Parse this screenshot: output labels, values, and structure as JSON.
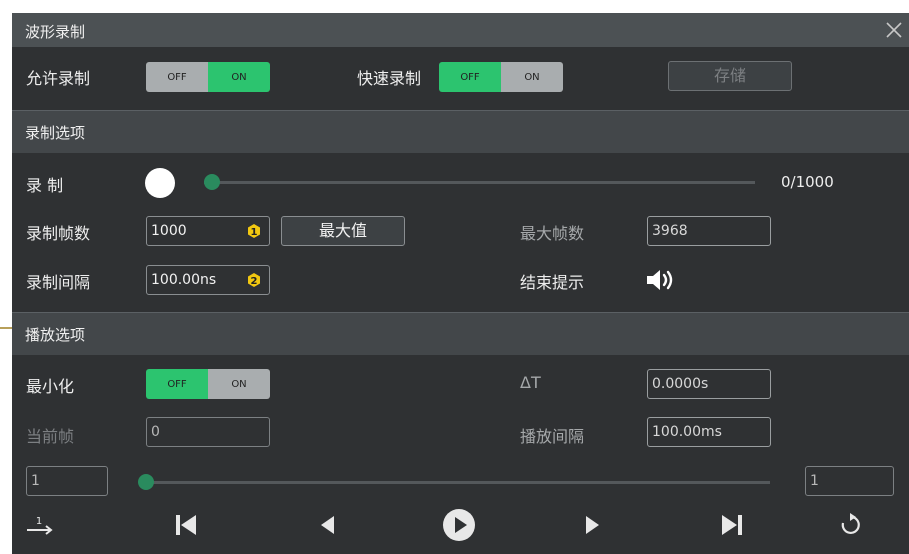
{
  "window": {
    "title": "波形录制"
  },
  "top": {
    "allow_label": "允许录制",
    "allow_toggle": {
      "off": "OFF",
      "on": "ON",
      "state": "ON"
    },
    "fast_label": "快速录制",
    "fast_toggle": {
      "off": "OFF",
      "on": "ON",
      "state": "OFF"
    },
    "save_label": "存储"
  },
  "record_section": {
    "title": "录制选项",
    "record_label": "录 制",
    "progress_text": "0/1000",
    "progress_value": 0,
    "frames_label": "录制帧数",
    "frames_value": "1000",
    "frames_badge": "1",
    "max_button": "最大值",
    "max_frames_label": "最大帧数",
    "max_frames_value": "3968",
    "interval_label": "录制间隔",
    "interval_value": "100.00ns",
    "interval_badge": "2",
    "end_hint_label": "结束提示",
    "end_hint_icon": "speaker-on-icon"
  },
  "play_section": {
    "title": "播放选项",
    "minimize_label": "最小化",
    "minimize_toggle": {
      "off": "OFF",
      "on": "ON",
      "state": "OFF"
    },
    "delta_t_label": "ΔT",
    "delta_t_value": "0.0000s",
    "current_frame_label": "当前帧",
    "current_frame_value": "0",
    "play_interval_label": "播放间隔",
    "play_interval_value": "100.00ms",
    "start_frame_value": "1",
    "end_frame_value": "1",
    "playback_position": 0
  },
  "toolbar": {
    "icons": [
      "order-icon",
      "skip-to-start-icon",
      "step-back-icon",
      "play-icon",
      "step-forward-icon",
      "skip-to-end-icon",
      "repeat-icon"
    ]
  },
  "colors": {
    "accent_green": "#2cc46f",
    "badge_yellow": "#f2c811",
    "background": "#2f3133"
  }
}
